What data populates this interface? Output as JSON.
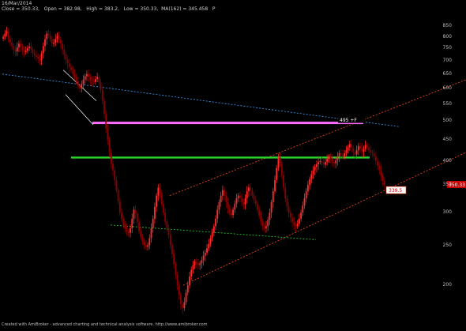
{
  "header": {
    "date": "16/Mar/2014",
    "ohlc_line": "Close = 350.33,   Open = 382.98,   High = 383.2,   Low = 350.33,  MA(162) = 345.458   P"
  },
  "footer": "Created with AmiBroker - advanced charting and technical analysis software. http://www.amibroker.com",
  "chart_data": {
    "type": "candlestick",
    "yscale": "log",
    "ylim": [
      170,
      920
    ],
    "yticks": [
      200,
      250,
      300,
      350,
      400,
      450,
      500,
      550,
      600,
      650,
      700,
      750,
      800,
      850
    ],
    "last_price": 350.33,
    "support_label": "339.5",
    "resistance_label": "495 +F",
    "colors": {
      "up": "#ff2a2a",
      "down": "#8b0000",
      "background": "#000000",
      "resistance": "#ff6aff",
      "mid_line": "#2bd62b",
      "channel": "#ff4a1a"
    },
    "close": [
      800,
      815,
      825,
      790,
      775,
      760,
      745,
      738,
      755,
      770,
      760,
      745,
      735,
      740,
      752,
      758,
      745,
      730,
      722,
      715,
      708,
      702,
      730,
      760,
      790,
      815,
      805,
      790,
      770,
      775,
      790,
      805,
      790,
      770,
      745,
      725,
      705,
      690,
      675,
      665,
      650,
      640,
      625,
      610,
      600,
      615,
      630,
      642,
      650,
      640,
      628,
      625,
      622,
      632,
      640,
      620,
      595,
      560,
      520,
      480,
      450,
      420,
      395,
      380,
      360,
      340,
      320,
      300,
      290,
      280,
      275,
      270,
      268,
      275,
      290,
      305,
      298,
      285,
      270,
      262,
      255,
      250,
      248,
      250,
      260,
      275,
      290,
      310,
      330,
      345,
      335,
      315,
      300,
      285,
      275,
      265,
      250,
      238,
      225,
      212,
      200,
      190,
      180,
      176,
      182,
      192,
      200,
      210,
      218,
      224,
      228,
      226,
      224,
      226,
      230,
      236,
      240,
      246,
      252,
      260,
      268,
      278,
      290,
      305,
      318,
      330,
      340,
      330,
      318,
      308,
      300,
      296,
      305,
      315,
      325,
      330,
      325,
      318,
      314,
      325,
      338,
      345,
      340,
      330,
      322,
      315,
      305,
      295,
      285,
      278,
      275,
      278,
      288,
      300,
      318,
      338,
      360,
      385,
      408,
      395,
      370,
      345,
      325,
      310,
      300,
      292,
      285,
      280,
      278,
      282,
      290,
      300,
      312,
      325,
      338,
      350,
      362,
      372,
      380,
      387,
      393,
      398,
      400,
      396,
      392,
      398,
      405,
      410,
      405,
      398,
      395,
      402,
      410,
      418,
      415,
      410,
      418,
      425,
      432,
      440,
      430,
      420,
      415,
      425,
      435,
      430,
      422,
      428,
      438,
      432,
      425,
      420,
      418,
      410,
      400,
      390,
      380,
      368,
      358,
      350.33
    ]
  }
}
